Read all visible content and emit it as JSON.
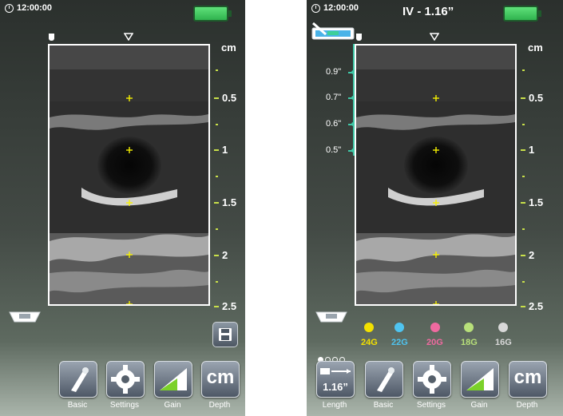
{
  "left": {
    "time": "12:00:00",
    "units": "cm",
    "depth_labels": [
      "0.5",
      "1",
      "1.5",
      "2",
      "2.5"
    ],
    "buttons": [
      {
        "label": "Basic",
        "icon": "probe-icon"
      },
      {
        "label": "Settings",
        "icon": "gear-icon"
      },
      {
        "label": "Gain",
        "icon": "gain-icon"
      },
      {
        "label": "Depth",
        "icon": "cm-icon",
        "text": "cm"
      }
    ]
  },
  "right": {
    "time": "12:00:00",
    "title": "IV - 1.16”",
    "units": "cm",
    "depth_labels": [
      "0.5",
      "1",
      "1.5",
      "2",
      "2.5"
    ],
    "needle_lengths": [
      "0.9\"",
      "0.7\"",
      "0.6\"",
      "0.5\""
    ],
    "gauges": [
      {
        "label": "24G",
        "color": "#f3e100"
      },
      {
        "label": "22G",
        "color": "#4fc4f0"
      },
      {
        "label": "20G",
        "color": "#f06aa0"
      },
      {
        "label": "18G",
        "color": "#b8e07a"
      },
      {
        "label": "16G",
        "color": "#d8d8d8"
      }
    ],
    "buttons": [
      {
        "label": "Length",
        "icon": "needle-length-icon",
        "text": "1.16”"
      },
      {
        "label": "Basic",
        "icon": "probe-icon"
      },
      {
        "label": "Settings",
        "icon": "gear-icon"
      },
      {
        "label": "Gain",
        "icon": "gain-icon"
      },
      {
        "label": "Depth",
        "icon": "cm-icon",
        "text": "cm"
      }
    ]
  },
  "colors": {
    "accent_green": "#c8e04a",
    "marker_yellow": "#f5f000",
    "needle_teal": "#40c9a8"
  }
}
